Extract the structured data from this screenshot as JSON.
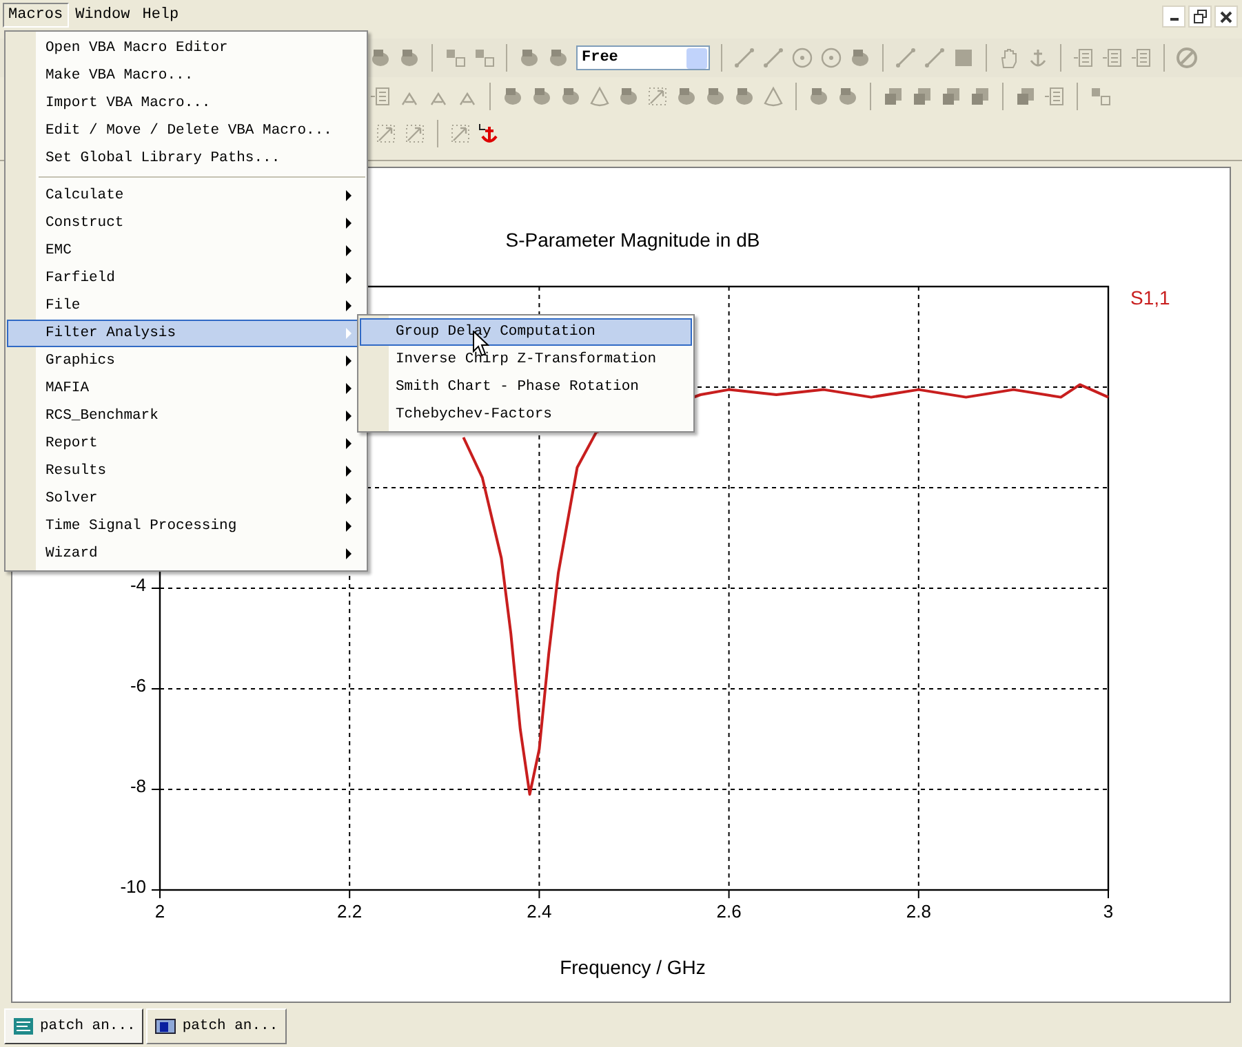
{
  "menubar": [
    {
      "label": "Macros",
      "selected": true
    },
    {
      "label": "Window",
      "selected": false
    },
    {
      "label": "Help",
      "selected": false
    }
  ],
  "toolbar": {
    "dropdown_value": "Free"
  },
  "macros_menu": {
    "groups": [
      [
        {
          "label": "Open VBA Macro Editor",
          "kind": "command",
          "selected": false
        },
        {
          "label": "Make VBA Macro...",
          "kind": "command",
          "selected": false
        },
        {
          "label": "Import VBA Macro...",
          "kind": "command",
          "selected": false
        },
        {
          "label": "Edit / Move / Delete VBA Macro...",
          "kind": "command",
          "selected": false
        },
        {
          "label": "Set Global Library Paths...",
          "kind": "command",
          "selected": false
        }
      ],
      [
        {
          "label": "Calculate",
          "kind": "submenu",
          "selected": false
        },
        {
          "label": "Construct",
          "kind": "submenu",
          "selected": false
        },
        {
          "label": "EMC",
          "kind": "submenu",
          "selected": false
        },
        {
          "label": "Farfield",
          "kind": "submenu",
          "selected": false
        },
        {
          "label": "File",
          "kind": "submenu",
          "selected": false
        },
        {
          "label": "Filter Analysis",
          "kind": "submenu",
          "selected": true
        },
        {
          "label": "Graphics",
          "kind": "submenu",
          "selected": false
        },
        {
          "label": "MAFIA",
          "kind": "submenu",
          "selected": false
        },
        {
          "label": "RCS_Benchmark",
          "kind": "submenu",
          "selected": false
        },
        {
          "label": "Report",
          "kind": "submenu",
          "selected": false
        },
        {
          "label": "Results",
          "kind": "submenu",
          "selected": false
        },
        {
          "label": "Solver",
          "kind": "submenu",
          "selected": false
        },
        {
          "label": "Time Signal Processing",
          "kind": "submenu",
          "selected": false
        },
        {
          "label": "Wizard",
          "kind": "submenu",
          "selected": false
        }
      ]
    ]
  },
  "submenu": {
    "items": [
      {
        "label": "Group Delay Computation",
        "selected": true
      },
      {
        "label": "Inverse Chirp Z-Transformation",
        "selected": false
      },
      {
        "label": "Smith Chart - Phase Rotation",
        "selected": false
      },
      {
        "label": "Tchebychev-Factors",
        "selected": false
      }
    ]
  },
  "plot": {
    "chart_data": {
      "type": "line",
      "title": "S-Parameter Magnitude in dB",
      "xlabel": "Frequency / GHz",
      "x": [
        2.32,
        2.34,
        2.36,
        2.37,
        2.38,
        2.39,
        2.4,
        2.41,
        2.42,
        2.44,
        2.46,
        2.57,
        2.6,
        2.65,
        2.7,
        2.75,
        2.8,
        2.85,
        2.9,
        2.95,
        2.97,
        3.0
      ],
      "series": [
        {
          "name": "S1,1",
          "color": "#c81e1e",
          "values": [
            -1.0,
            -1.8,
            -3.4,
            -4.9,
            -6.8,
            -8.1,
            -7.2,
            -5.3,
            -3.7,
            -1.6,
            -0.9,
            -0.15,
            -0.05,
            -0.15,
            -0.05,
            -0.2,
            -0.05,
            -0.2,
            -0.05,
            -0.2,
            0.05,
            -0.2
          ]
        }
      ],
      "grid": true,
      "xlim": [
        2,
        3
      ],
      "ylim": [
        -10,
        2
      ],
      "xticks": [
        2,
        2.2,
        2.4,
        2.6,
        2.8,
        3
      ],
      "yticks": [
        -10,
        -8,
        -6,
        -4
      ]
    }
  },
  "window_tabs": [
    {
      "label": "patch an...",
      "selected": true
    },
    {
      "label": "patch an...",
      "selected": false
    }
  ]
}
